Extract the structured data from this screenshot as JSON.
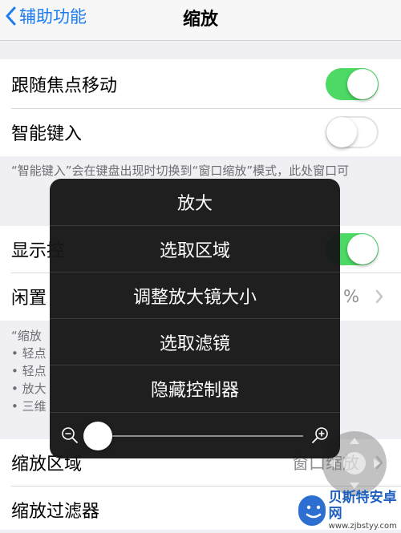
{
  "navbar": {
    "back_label": "辅助功能",
    "title": "缩放"
  },
  "settings": {
    "follow_focus": {
      "label": "跟随焦点移动",
      "on": true
    },
    "smart_typing": {
      "label": "智能键入",
      "on": false
    },
    "smart_typing_footnote": "“智能键入”会在键盘出现时切换到“窗口缩放”模式，此处窗口可",
    "show_controller": {
      "label": "显示控",
      "on": true
    },
    "idle": {
      "label": "闲置",
      "value": "%"
    },
    "footnote2_prefix": "“缩放",
    "bullets": [
      "• 轻点",
      "• 轻点",
      "• 放大",
      "• 三维"
    ],
    "zoom_region": {
      "label": "缩放区域",
      "value": "窗口缩放"
    },
    "zoom_filter": {
      "label": "缩放过滤器"
    }
  },
  "popup_menu": {
    "items": [
      "放大",
      "选取区域",
      "调整放大镜大小",
      "选取滤镜",
      "隐藏控制器"
    ],
    "zoom_level_fraction": 0.0
  },
  "watermark": {
    "title": "贝斯特安卓网",
    "url": "www.zjbstyy.com"
  },
  "colors": {
    "accent": "#1d7df0",
    "toggle_on": "#4cd964",
    "menu_bg": "#161616"
  }
}
